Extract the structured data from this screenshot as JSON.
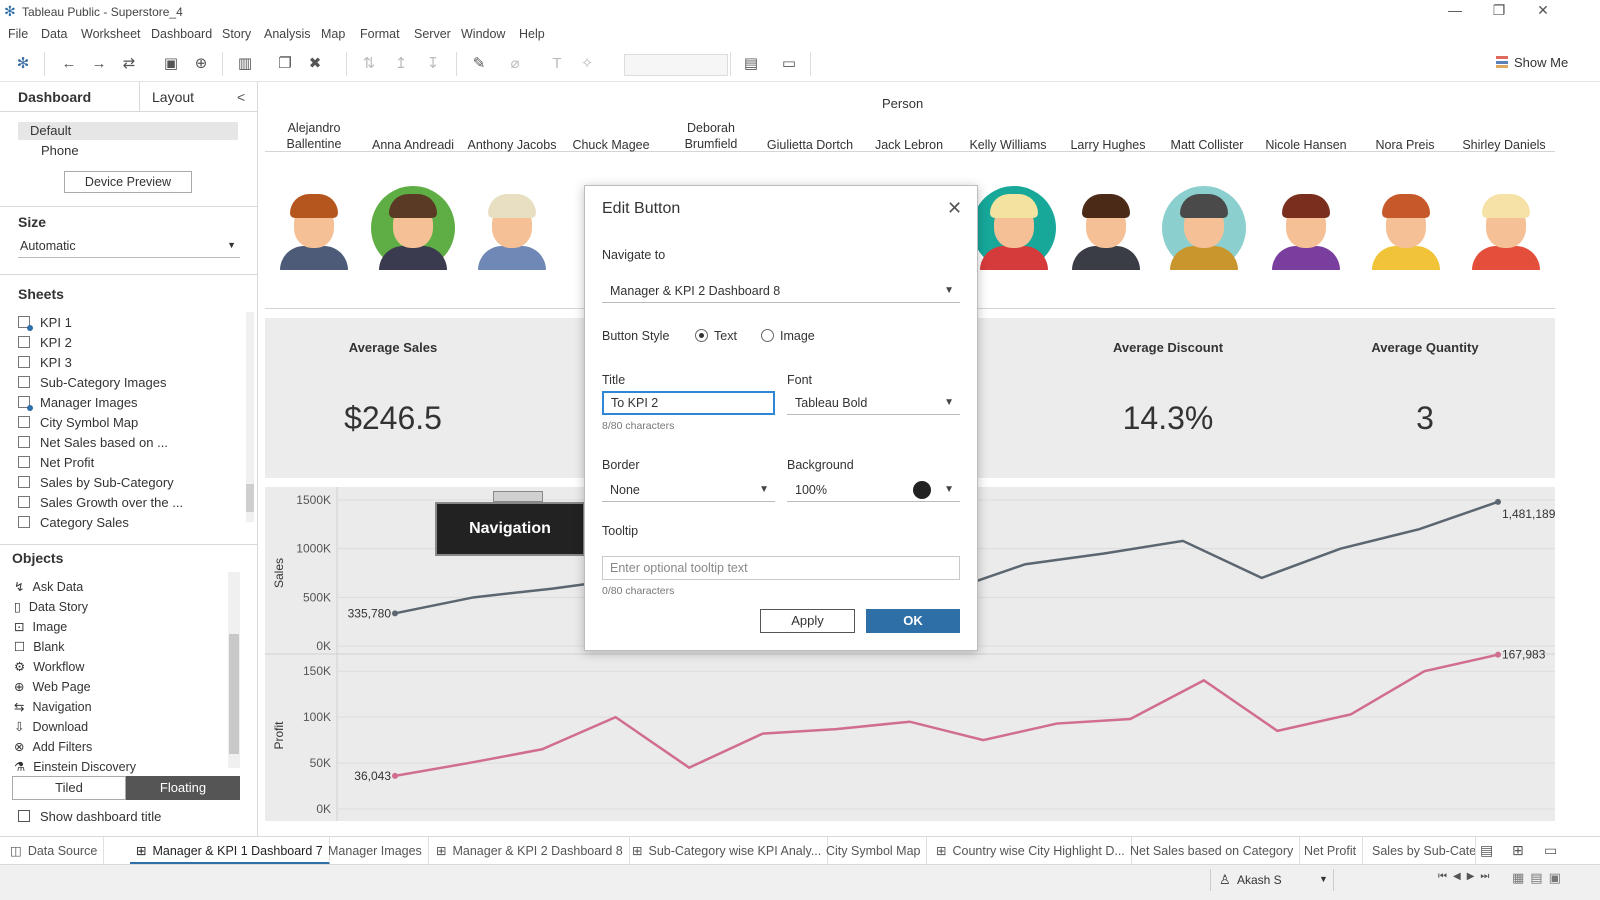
{
  "window": {
    "title": "Tableau Public - Superstore_4",
    "controls": {
      "minimize": "—",
      "maximize": "❐",
      "close": "✕"
    }
  },
  "menu": [
    "File",
    "Data",
    "Worksheet",
    "Dashboard",
    "Story",
    "Analysis",
    "Map",
    "Format",
    "Server",
    "Window",
    "Help"
  ],
  "toolbar": {
    "show_me": "Show Me"
  },
  "left_panel": {
    "tabs": {
      "dashboard": "Dashboard",
      "layout": "Layout",
      "collapse": "<"
    },
    "devices": {
      "default": "Default",
      "phone": "Phone",
      "preview_button": "Device Preview"
    },
    "size": {
      "heading": "Size",
      "value": "Automatic"
    },
    "sheets": {
      "heading": "Sheets",
      "items": [
        "KPI 1",
        "KPI 2",
        "KPI 3",
        "Sub-Category Images",
        "Manager Images",
        "City Symbol Map",
        "Net Sales based on ...",
        "Net Profit",
        "Sales by Sub-Category",
        "Sales Growth over the ...",
        "Category Sales"
      ]
    },
    "objects": {
      "heading": "Objects",
      "items": [
        "Ask Data",
        "Data Story",
        "Image",
        "Blank",
        "Workflow",
        "Web Page",
        "Navigation",
        "Download",
        "Add Filters",
        "Einstein Discovery"
      ]
    },
    "layout_toggle": {
      "tiled": "Tiled",
      "floating": "Floating"
    },
    "show_title": "Show dashboard title"
  },
  "dashboard": {
    "person_header": "Person",
    "persons": [
      "Alejandro Ballentine",
      "Anna Andreadi",
      "Anthony Jacobs",
      "Chuck Magee",
      "Deborah Brumfield",
      "Giulietta Dortch",
      "Jack Lebron",
      "Kelly Williams",
      "Larry Hughes",
      "Matt Collister",
      "Nicole Hansen",
      "Nora Preis",
      "Shirley Daniels"
    ],
    "kpis": [
      {
        "title": "Average Sales",
        "value": "$246.5"
      },
      {
        "title": "Average Discount",
        "value": "14.3%"
      },
      {
        "title": "Average Quantity",
        "value": "3"
      }
    ],
    "navigation_button": "Navigation"
  },
  "chart_data": [
    {
      "type": "line",
      "ylabel": "Sales",
      "ylim": [
        0,
        1500000
      ],
      "yticks": [
        "1500K",
        "1000K",
        "500K",
        "0K"
      ],
      "grid": true,
      "annotations": [
        "335,780",
        "1,481,189"
      ],
      "values": [
        335780,
        500000,
        590000,
        700000,
        680000,
        720000,
        780000,
        560000,
        840000,
        950000,
        1080000,
        700000,
        1000000,
        1200000,
        1481189
      ]
    },
    {
      "type": "line",
      "ylabel": "Profit",
      "ylim": [
        0,
        160000
      ],
      "yticks": [
        "150K",
        "100K",
        "50K",
        "0K"
      ],
      "grid": true,
      "annotations": [
        "36,043",
        "167,983"
      ],
      "values": [
        36043,
        50000,
        65000,
        100000,
        45000,
        82000,
        87000,
        95000,
        75000,
        93000,
        98000,
        140000,
        85000,
        103000,
        150000,
        167983
      ]
    }
  ],
  "dialog": {
    "title": "Edit Button",
    "close": "✕",
    "navigate_label": "Navigate to",
    "navigate_value": "Manager & KPI 2 Dashboard 8",
    "button_style_label": "Button Style",
    "style_text": "Text",
    "style_image": "Image",
    "title_label": "Title",
    "title_value": "To KPI 2",
    "title_count": "8/80 characters",
    "font_label": "Font",
    "font_value": "Tableau Bold",
    "border_label": "Border",
    "border_value": "None",
    "background_label": "Background",
    "background_value": "100%",
    "background_color": "#222222",
    "tooltip_label": "Tooltip",
    "tooltip_placeholder": "Enter optional tooltip text",
    "tooltip_count": "0/80 characters",
    "apply": "Apply",
    "ok": "OK"
  },
  "sheet_tabs": [
    "Data Source",
    "Manager & KPI 1 Dashboard 7",
    "Manager Images",
    "Manager & KPI 2 Dashboard 8",
    "Sub-Category wise KPI Analy...",
    "City Symbol Map",
    "Country wise City Highlight D...",
    "Net Sales based on Category",
    "Net Profit",
    "Sales by Sub-Cate"
  ],
  "status": {
    "user": "Akash S"
  },
  "colors": {
    "accent": "#2f6fa8",
    "sales_line": "#5c6670",
    "profit_line": "#d16d8f",
    "ok_button": "#2f6fa8"
  }
}
